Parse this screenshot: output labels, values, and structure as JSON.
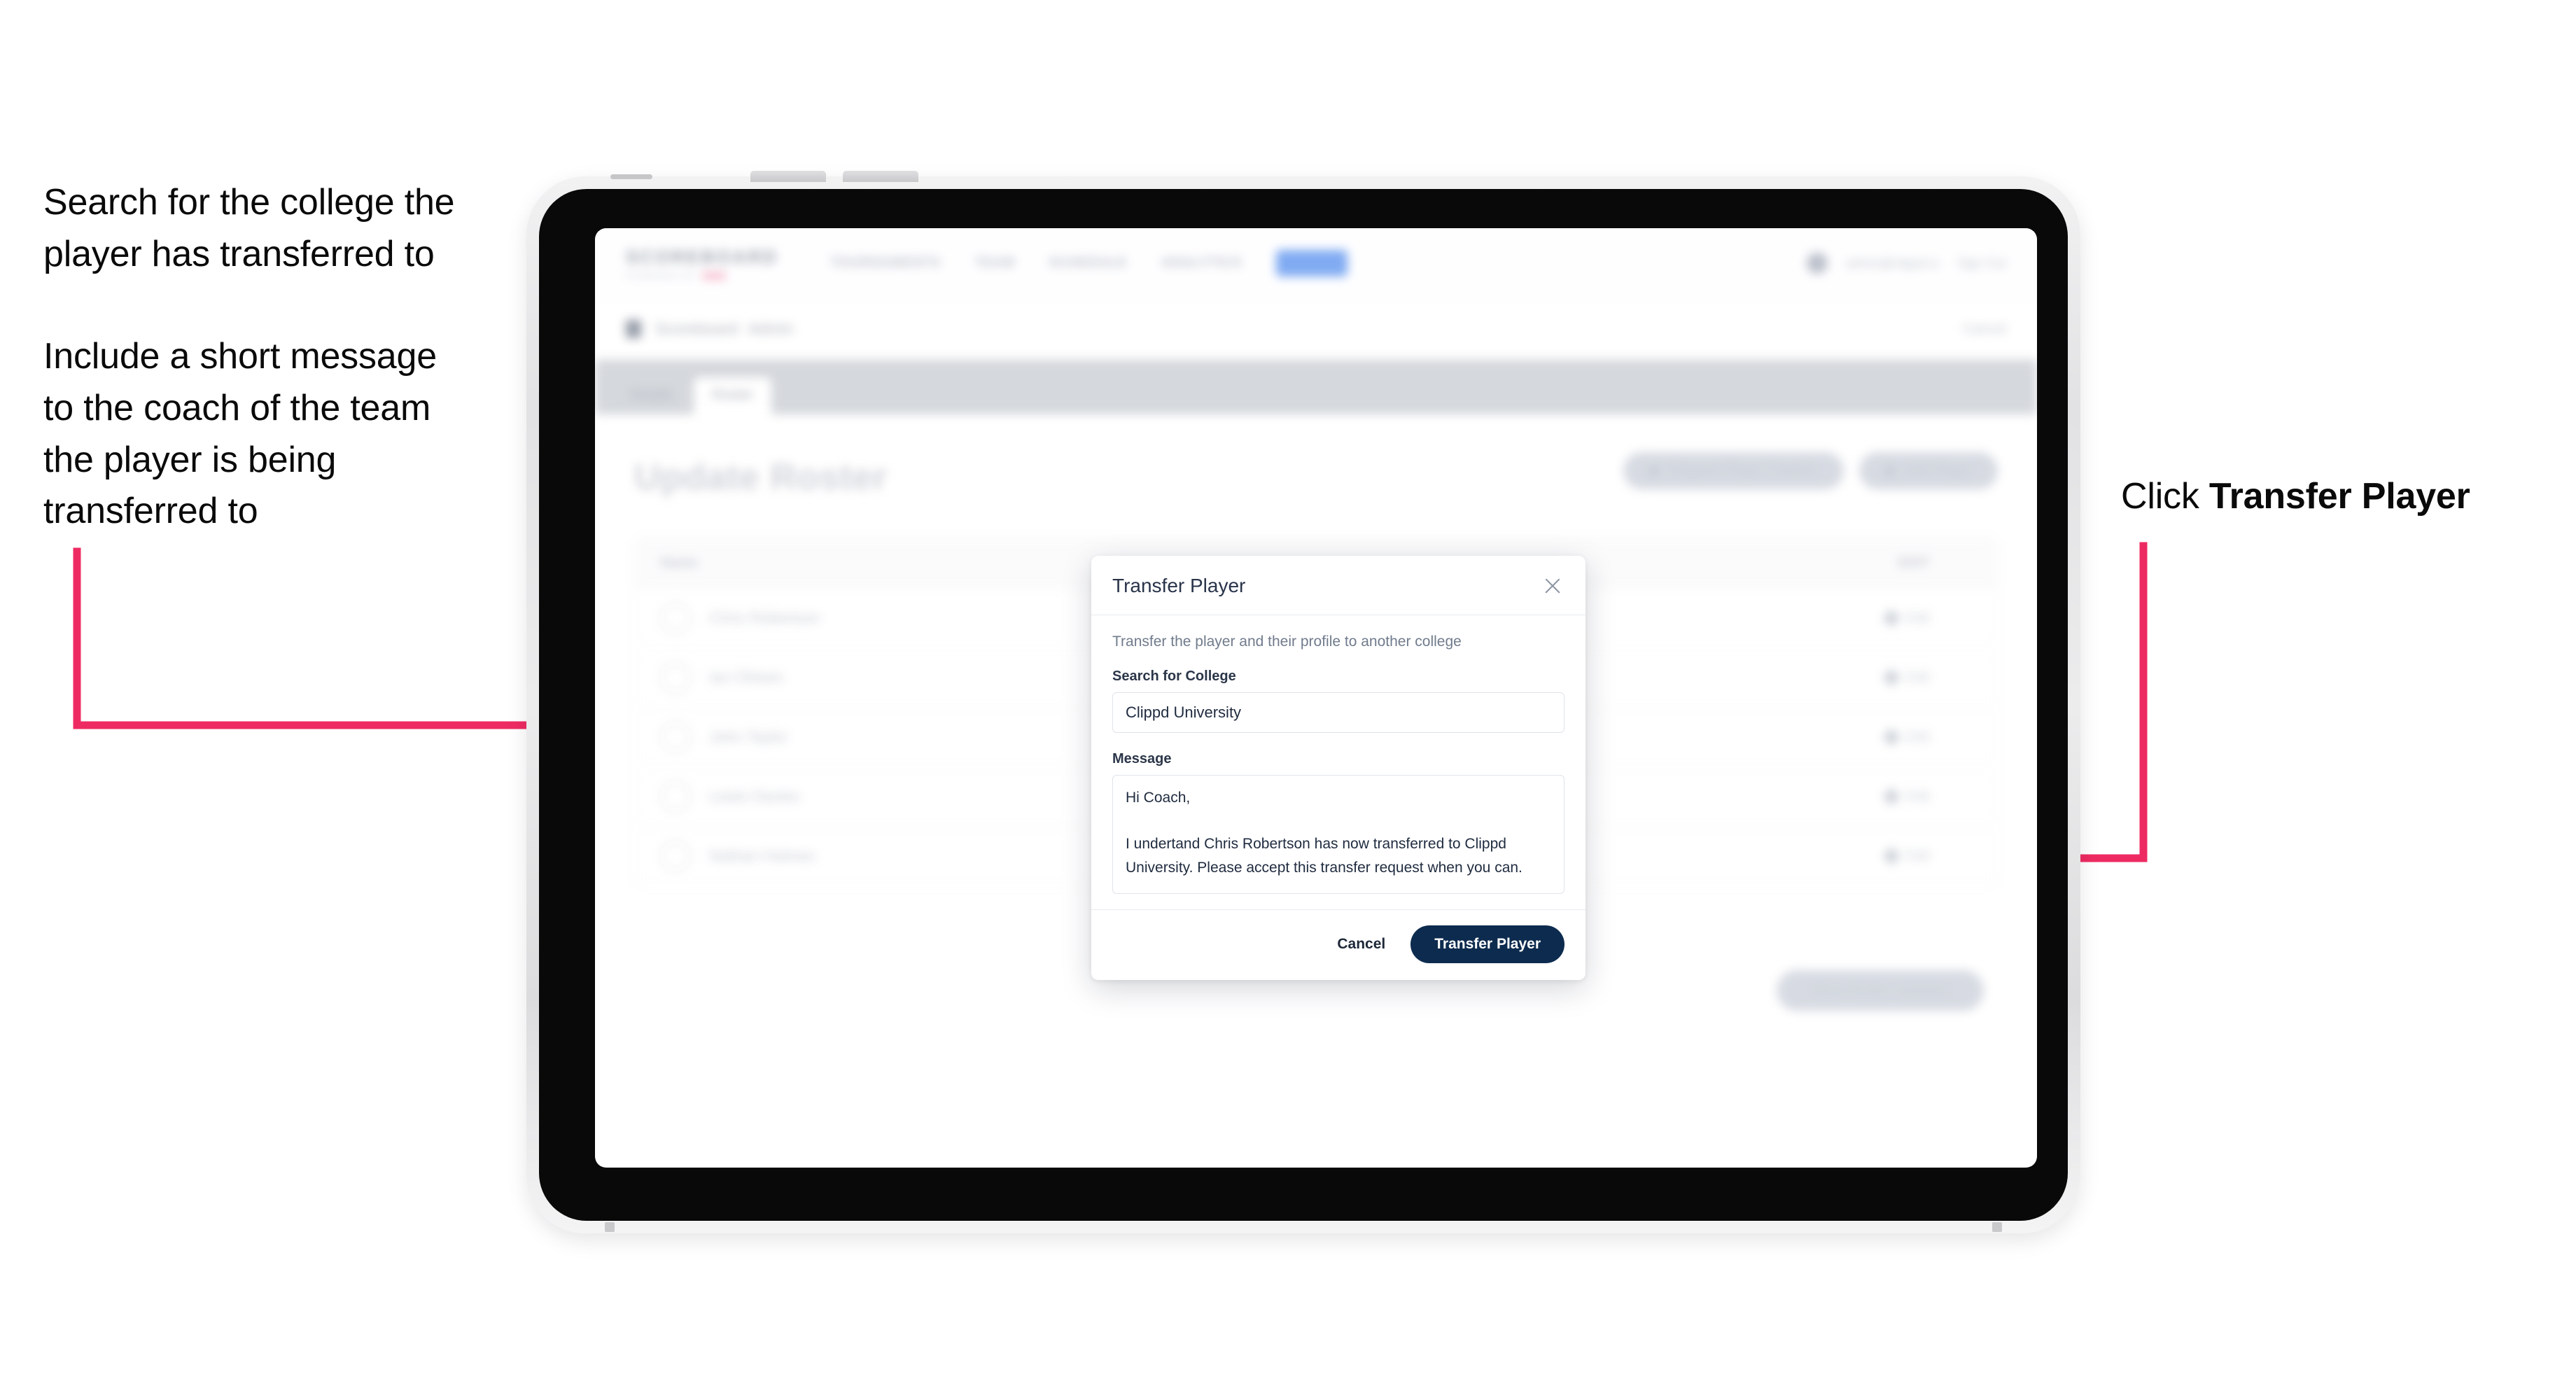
{
  "annotations": {
    "left_1": "Search for the college the\nplayer has transferred to",
    "left_2": "Include a short message\nto the coach of the team\nthe player is being\ntransferred to",
    "right_1_prefix": "Click ",
    "right_1_bold": "Transfer Player"
  },
  "colors": {
    "arrow_pink": "#ee2a62",
    "primary_navy": "#0d2b4e",
    "brand_pink": "#f6b9cb",
    "nav_pill_blue": "#7aa7f2",
    "modal_border": "#dfe3e9",
    "annotation_text": "#0a0a0a"
  },
  "app": {
    "brand": {
      "wordmark": "SCOREBOARD",
      "tagline": "POWERED BY",
      "tagline_mark": "clippd"
    },
    "nav": [
      {
        "label": "TOURNAMENTS"
      },
      {
        "label": "TEAM"
      },
      {
        "label": "SCHEDULE"
      },
      {
        "label": "ANALYTICS"
      },
      {
        "label": "ADMIN"
      }
    ],
    "header_right": {
      "avatar": "user-avatar",
      "email": "admin@clippd.io",
      "sign_out": "Sign Out"
    },
    "breadcrumb": {
      "icon": "scoreboard-icon",
      "text": "Scoreboard",
      "text_muted": "Admin",
      "right_action": "Cancel"
    },
    "tabs": [
      {
        "label": "Details",
        "active": false
      },
      {
        "label": "Roster",
        "active": true
      }
    ],
    "page_title": "Update Roster",
    "actions": [
      {
        "label": "Request Player Transfer",
        "icon": "transfer-icon"
      },
      {
        "label": "Add Player",
        "icon": "plus-icon"
      }
    ],
    "roster": {
      "columns": [
        "Name",
        "EDIT"
      ],
      "rows": [
        {
          "name": "Chris Robertson",
          "edit": "Edit"
        },
        {
          "name": "Ian Ohlsen",
          "edit": "Edit"
        },
        {
          "name": "John Taylor",
          "edit": "Edit"
        },
        {
          "name": "Lewis Davies",
          "edit": "Edit"
        },
        {
          "name": "Nathan Holmes",
          "edit": "Edit"
        }
      ]
    },
    "save_button": "Save Roster Updates"
  },
  "modal": {
    "title": "Transfer Player",
    "close_icon": "close-icon",
    "description": "Transfer the player and their profile to another college",
    "college_field": {
      "label": "Search for College",
      "value": "Clippd University",
      "placeholder": "Search for College"
    },
    "message_field": {
      "label": "Message",
      "value": "Hi Coach,\n\nI undertand Chris Robertson has now transferred to Clippd University. Please accept this transfer request when you can.",
      "placeholder": "Message"
    },
    "cancel_label": "Cancel",
    "submit_label": "Transfer Player"
  }
}
